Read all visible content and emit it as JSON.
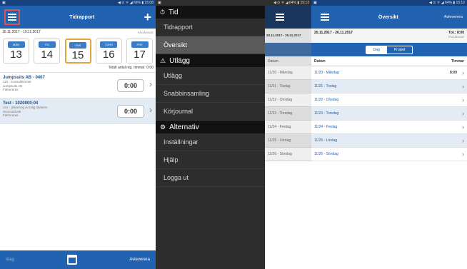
{
  "screen1": {
    "status": {
      "left": "▣",
      "right": "◀ ⊙ ᯤ ◢ 66% ▮ 15:08"
    },
    "title": "Tidrapport",
    "add": "+",
    "range": "15.11.2017 - 19.11.2017",
    "range_state": "PÅGÅENDE",
    "days": [
      {
        "name": "MÅN",
        "num": "13"
      },
      {
        "name": "TIS",
        "num": "14"
      },
      {
        "name": "ONS",
        "num": "15"
      },
      {
        "name": "TORS",
        "num": "16"
      },
      {
        "name": "FRE",
        "num": "17"
      }
    ],
    "total_line": "Totalt antal reg. timmar: 0:00",
    "entries": [
      {
        "title": "Jumpsuits AB - 0407",
        "lines": [
          "110 - Konsulttimmar",
          "Jumpsuits AB",
          "Faktureras"
        ],
        "hours": "0:00"
      },
      {
        "title": "Test - 1020000-04",
        "lines": [
          "101 - planering av bilig tävlaren",
          "Sommarlunk",
          "Faktureras"
        ],
        "hours": "0:00"
      }
    ],
    "bottom": {
      "left": "Idag",
      "right": "Avleverera"
    }
  },
  "screen2": {
    "status": {
      "left": "▣",
      "right": "◀ ⊙ ᯤ ◢ 64% ▮ 15:13"
    },
    "groups": [
      {
        "header": "Tid",
        "icon": "⏱",
        "items": [
          "Tidrapport",
          "Översikt"
        ]
      },
      {
        "header": "Utlägg",
        "icon": "⚠",
        "items": [
          "Utlägg",
          "Snabbinsamling",
          "Körjournal"
        ]
      },
      {
        "header": "Alternativ",
        "icon": "⚙",
        "items": [
          "Inställningar",
          "Hjälp",
          "Logga ut"
        ]
      }
    ],
    "behind": {
      "range": "20.11.2017 - 26.11.2017",
      "header": "Datum",
      "rows": [
        "11/20 - Måndag",
        "11/21 - Tisdag",
        "11/22 - Onsdag",
        "11/23 - Torsdag",
        "11/24 - Fredag",
        "11/25 - Lördag",
        "11/26 - Söndag"
      ]
    }
  },
  "screen3": {
    "status": {
      "left": "▣",
      "right": "◀ ⊙ ᯤ ◢ 64% ▮ 15:12"
    },
    "title": "Översikt",
    "action": "Avleverera",
    "range": "20.11.2017 - 26.11.2017",
    "total": "Tot.: 8:00",
    "total_state": "PÅGÅENDE",
    "seg": {
      "day": "Dag",
      "project": "Projekt"
    },
    "columns": {
      "date": "Datum",
      "hours": "Timmar"
    },
    "rows": [
      {
        "date": "11/20 - Måndag",
        "hours": "8:00"
      },
      {
        "date": "11/21 - Tisdag",
        "hours": ""
      },
      {
        "date": "11/22 - Onsdag",
        "hours": ""
      },
      {
        "date": "11/23 - Torsdag",
        "hours": ""
      },
      {
        "date": "11/24 - Fredag",
        "hours": ""
      },
      {
        "date": "11/25 - Lördag",
        "hours": ""
      },
      {
        "date": "11/26 - Söndag",
        "hours": ""
      }
    ]
  },
  "colors": {
    "primary": "#2163b0",
    "dark": "#16417c",
    "drawer": "#2d2d2d",
    "selected_day": "#e3a23a",
    "menu_highlight": "#d9534f"
  }
}
